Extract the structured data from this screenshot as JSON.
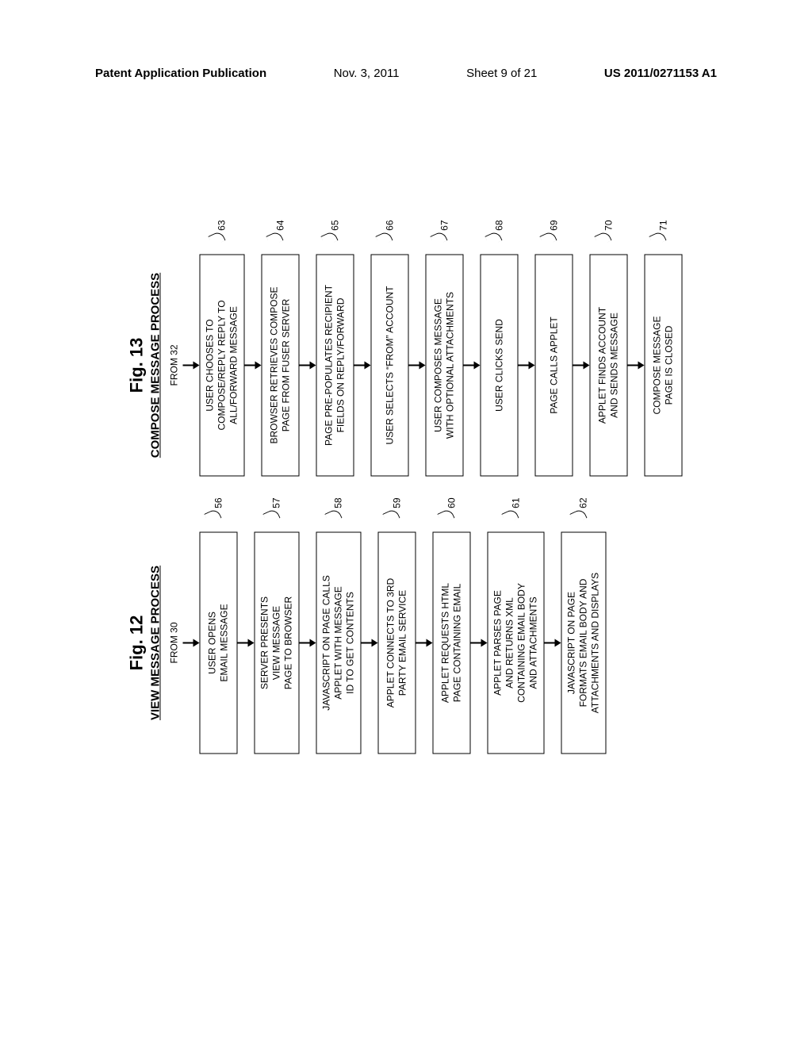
{
  "header": {
    "pub_label": "Patent Application Publication",
    "date": "Nov. 3, 2011",
    "sheet": "Sheet 9 of 21",
    "pubno": "US 2011/0271153 A1"
  },
  "fig12": {
    "label": "Fig. 12",
    "subtitle": "VIEW MESSAGE PROCESS",
    "from": "FROM 30",
    "steps": [
      {
        "ref": "56",
        "text": "USER OPENS\nEMAIL MESSAGE"
      },
      {
        "ref": "57",
        "text": "SERVER PRESENTS\nVIEW MESSAGE\nPAGE TO BROWSER"
      },
      {
        "ref": "58",
        "text": "JAVASCRIPT ON PAGE CALLS\nAPPLET WITH MESSAGE\nID TO GET CONTENTS"
      },
      {
        "ref": "59",
        "text": "APPLET CONNECTS TO 3RD\nPARTY EMAIL SERVICE"
      },
      {
        "ref": "60",
        "text": "APPLET REQUESTS HTML\nPAGE CONTAINING EMAIL"
      },
      {
        "ref": "61",
        "text": "APPLET PARSES PAGE\nAND RETURNS XML\nCONTAINING EMAIL BODY\nAND ATTACHMENTS"
      },
      {
        "ref": "62",
        "text": "JAVASCRIPT ON PAGE\nFORMATS EMAIL BODY AND\nATTACHMENTS AND DISPLAYS"
      }
    ]
  },
  "fig13": {
    "label": "Fig. 13",
    "subtitle": "COMPOSE MESSAGE PROCESS",
    "from": "FROM 32",
    "steps": [
      {
        "ref": "63",
        "text": "USER CHOOSES TO\nCOMPOSE/REPLY REPLY TO\nALL/FORWARD MESSAGE"
      },
      {
        "ref": "64",
        "text": "BROWSER RETRIEVES COMPOSE\nPAGE FROM FUSER SERVER"
      },
      {
        "ref": "65",
        "text": "PAGE PRE-POPULATES RECIPIENT\nFIELDS ON REPLY/FORWARD"
      },
      {
        "ref": "66",
        "text": "USER SELECTS “FROM” ACCOUNT"
      },
      {
        "ref": "67",
        "text": "USER COMPOSES MESSAGE\nWITH OPTIONAL ATTACHMENTS"
      },
      {
        "ref": "68",
        "text": "USER CLICKS SEND"
      },
      {
        "ref": "69",
        "text": "PAGE CALLS APPLET"
      },
      {
        "ref": "70",
        "text": "APPLET FINDS ACCOUNT\nAND SENDS MESSAGE"
      },
      {
        "ref": "71",
        "text": "COMPOSE MESSAGE\nPAGE IS CLOSED"
      }
    ]
  }
}
